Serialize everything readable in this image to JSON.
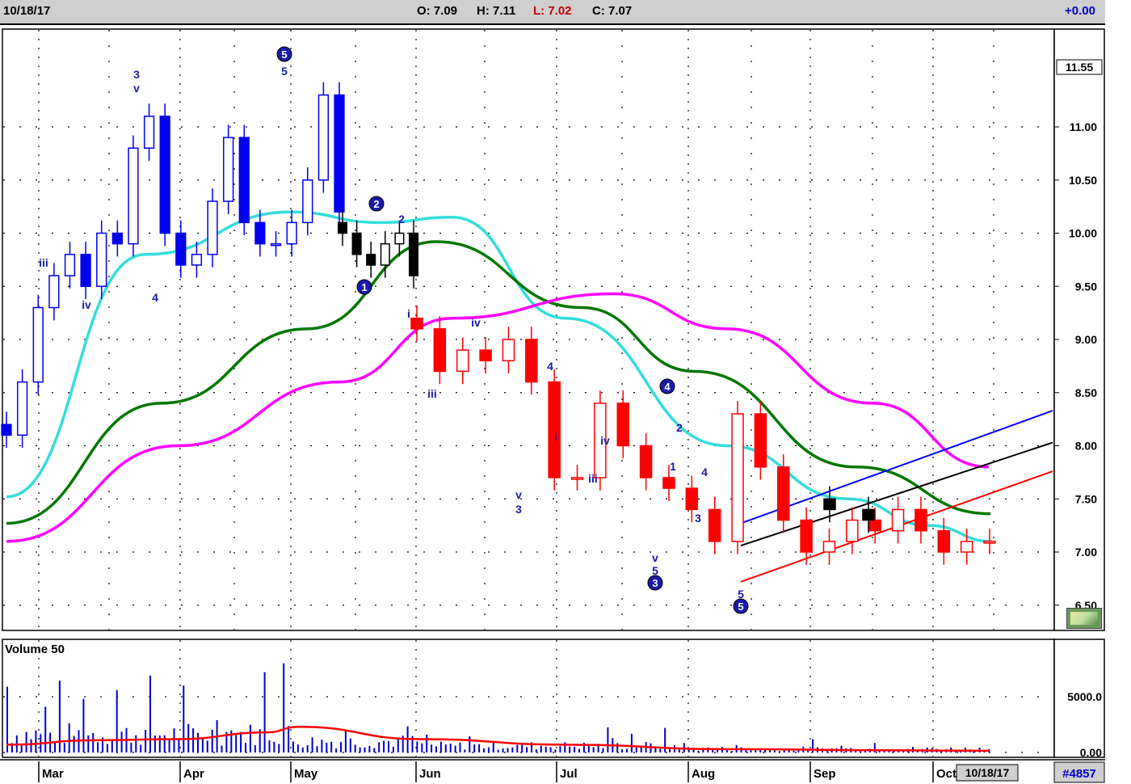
{
  "header": {
    "date": "10/18/17",
    "open_label": "O: 7.09",
    "high_label": "H: 7.11",
    "low_label": "L: 7.02",
    "close_label": "C: 7.07",
    "change": "+0.00"
  },
  "price_panel": {
    "last_price_label": "11.55",
    "y_ticks": [
      "6.50",
      "7.00",
      "7.50",
      "8.00",
      "8.50",
      "9.00",
      "9.50",
      "10.00",
      "10.50",
      "11.00"
    ]
  },
  "volume_panel": {
    "title": "Volume 50",
    "y_ticks": [
      "0.00",
      "5000.0"
    ]
  },
  "x_axis": {
    "months": [
      "Mar",
      "Apr",
      "May",
      "Jun",
      "Jul",
      "Aug",
      "Sep",
      "Oct"
    ],
    "date_box": "10/18/17",
    "symbol_code": "#4857"
  },
  "wave_labels": [
    {
      "text": "5",
      "circled": true
    },
    {
      "text": "5",
      "circled": false
    },
    {
      "text": "3",
      "circled": false
    },
    {
      "text": "v",
      "circled": false
    },
    {
      "text": "iii",
      "circled": false
    },
    {
      "text": "iv",
      "circled": false
    },
    {
      "text": "4",
      "circled": false
    },
    {
      "text": "2",
      "circled": true
    },
    {
      "text": "2",
      "circled": false
    },
    {
      "text": "1",
      "circled": true
    },
    {
      "text": "i",
      "circled": false
    },
    {
      "text": "iii",
      "circled": false
    },
    {
      "text": "iv",
      "circled": false
    },
    {
      "text": "v",
      "circled": false
    },
    {
      "text": "3",
      "circled": false
    },
    {
      "text": "4",
      "circled": false
    },
    {
      "text": "i",
      "circled": false
    },
    {
      "text": "iv",
      "circled": false
    },
    {
      "text": "iii",
      "circled": false
    },
    {
      "text": "v",
      "circled": false
    },
    {
      "text": "5",
      "circled": false
    },
    {
      "text": "3",
      "circled": true
    },
    {
      "text": "4",
      "circled": true
    },
    {
      "text": "2",
      "circled": false
    },
    {
      "text": "1",
      "circled": false
    },
    {
      "text": "4",
      "circled": false
    },
    {
      "text": "3",
      "circled": false
    },
    {
      "text": "5",
      "circled": false
    },
    {
      "text": "5",
      "circled": true
    }
  ],
  "chart_data": {
    "type": "candlestick",
    "x_labels": [
      "Mar",
      "Apr",
      "May",
      "Jun",
      "Jul",
      "Aug",
      "Sep",
      "Oct"
    ],
    "price_ylim": [
      6.25,
      11.85
    ],
    "volume_ylim": [
      0,
      8000
    ],
    "grid": true,
    "price_series": [
      {
        "color": "#0000ee",
        "close": [
          8.1,
          8.6,
          9.3,
          9.6,
          9.8,
          9.5,
          10.0,
          9.9,
          10.8,
          11.1,
          10.0,
          9.7,
          9.8,
          10.3,
          10.9,
          10.1,
          9.9,
          9.9,
          10.1,
          10.5,
          11.3,
          10.2
        ]
      },
      {
        "color": "#000000",
        "close": [
          10.0,
          9.8,
          9.7,
          9.9,
          10.0,
          9.6
        ]
      },
      {
        "color": "#ff0000",
        "close": [
          9.1,
          8.7,
          8.9,
          8.8,
          9.0,
          8.6,
          7.7,
          7.7,
          8.4,
          8.0,
          7.7,
          7.6,
          7.4,
          7.1,
          8.3,
          7.8,
          7.3,
          7.0,
          7.1,
          7.3,
          7.2,
          7.4,
          7.2,
          7.0,
          7.1,
          7.1
        ]
      },
      {
        "color": "#000000",
        "close": [
          7.4,
          7.3
        ]
      }
    ],
    "overlays": [
      {
        "name": "cyan moving average",
        "color": "#33dddd",
        "y": [
          7.52,
          9.8,
          10.2,
          10.1,
          10.15,
          9.2,
          8.0,
          7.5,
          7.25,
          7.1
        ]
      },
      {
        "name": "green moving average",
        "color": "#007700",
        "y": [
          7.27,
          8.4,
          9.1,
          9.92,
          9.3,
          8.7,
          7.8,
          7.36
        ]
      },
      {
        "name": "magenta moving average",
        "color": "#ff00ff",
        "y": [
          7.1,
          8.0,
          8.6,
          9.2,
          9.43,
          9.1,
          8.4,
          7.8
        ]
      }
    ],
    "channel_lines": [
      {
        "color": "#0000ff",
        "y": [
          7.27,
          8.33
        ]
      },
      {
        "color": "#000000",
        "y": [
          7.06,
          8.03
        ]
      },
      {
        "color": "#ff0000",
        "y": [
          6.72,
          7.76
        ]
      }
    ],
    "volume": {
      "bar_color": "#0000cc",
      "average_color": "#ff0000",
      "average_y": [
        700,
        1100,
        1200,
        1800,
        2300,
        1200,
        700,
        300,
        200,
        150
      ]
    }
  }
}
